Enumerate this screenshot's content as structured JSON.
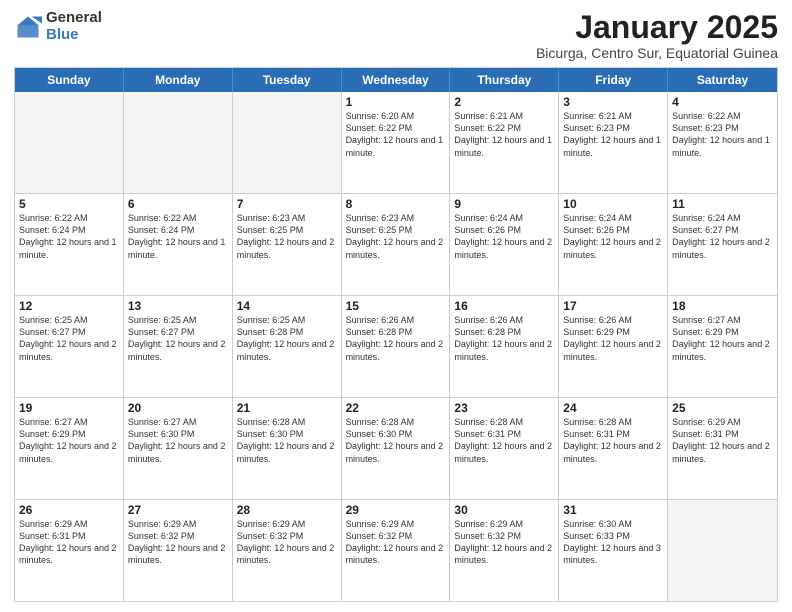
{
  "logo": {
    "general": "General",
    "blue": "Blue"
  },
  "header": {
    "title": "January 2025",
    "subtitle": "Bicurga, Centro Sur, Equatorial Guinea"
  },
  "weekdays": [
    "Sunday",
    "Monday",
    "Tuesday",
    "Wednesday",
    "Thursday",
    "Friday",
    "Saturday"
  ],
  "weeks": [
    [
      {
        "num": "",
        "info": "",
        "empty": true
      },
      {
        "num": "",
        "info": "",
        "empty": true
      },
      {
        "num": "",
        "info": "",
        "empty": true
      },
      {
        "num": "1",
        "info": "Sunrise: 6:20 AM\nSunset: 6:22 PM\nDaylight: 12 hours and 1 minute.",
        "empty": false
      },
      {
        "num": "2",
        "info": "Sunrise: 6:21 AM\nSunset: 6:22 PM\nDaylight: 12 hours and 1 minute.",
        "empty": false
      },
      {
        "num": "3",
        "info": "Sunrise: 6:21 AM\nSunset: 6:23 PM\nDaylight: 12 hours and 1 minute.",
        "empty": false
      },
      {
        "num": "4",
        "info": "Sunrise: 6:22 AM\nSunset: 6:23 PM\nDaylight: 12 hours and 1 minute.",
        "empty": false
      }
    ],
    [
      {
        "num": "5",
        "info": "Sunrise: 6:22 AM\nSunset: 6:24 PM\nDaylight: 12 hours and 1 minute.",
        "empty": false
      },
      {
        "num": "6",
        "info": "Sunrise: 6:22 AM\nSunset: 6:24 PM\nDaylight: 12 hours and 1 minute.",
        "empty": false
      },
      {
        "num": "7",
        "info": "Sunrise: 6:23 AM\nSunset: 6:25 PM\nDaylight: 12 hours and 2 minutes.",
        "empty": false
      },
      {
        "num": "8",
        "info": "Sunrise: 6:23 AM\nSunset: 6:25 PM\nDaylight: 12 hours and 2 minutes.",
        "empty": false
      },
      {
        "num": "9",
        "info": "Sunrise: 6:24 AM\nSunset: 6:26 PM\nDaylight: 12 hours and 2 minutes.",
        "empty": false
      },
      {
        "num": "10",
        "info": "Sunrise: 6:24 AM\nSunset: 6:26 PM\nDaylight: 12 hours and 2 minutes.",
        "empty": false
      },
      {
        "num": "11",
        "info": "Sunrise: 6:24 AM\nSunset: 6:27 PM\nDaylight: 12 hours and 2 minutes.",
        "empty": false
      }
    ],
    [
      {
        "num": "12",
        "info": "Sunrise: 6:25 AM\nSunset: 6:27 PM\nDaylight: 12 hours and 2 minutes.",
        "empty": false
      },
      {
        "num": "13",
        "info": "Sunrise: 6:25 AM\nSunset: 6:27 PM\nDaylight: 12 hours and 2 minutes.",
        "empty": false
      },
      {
        "num": "14",
        "info": "Sunrise: 6:25 AM\nSunset: 6:28 PM\nDaylight: 12 hours and 2 minutes.",
        "empty": false
      },
      {
        "num": "15",
        "info": "Sunrise: 6:26 AM\nSunset: 6:28 PM\nDaylight: 12 hours and 2 minutes.",
        "empty": false
      },
      {
        "num": "16",
        "info": "Sunrise: 6:26 AM\nSunset: 6:28 PM\nDaylight: 12 hours and 2 minutes.",
        "empty": false
      },
      {
        "num": "17",
        "info": "Sunrise: 6:26 AM\nSunset: 6:29 PM\nDaylight: 12 hours and 2 minutes.",
        "empty": false
      },
      {
        "num": "18",
        "info": "Sunrise: 6:27 AM\nSunset: 6:29 PM\nDaylight: 12 hours and 2 minutes.",
        "empty": false
      }
    ],
    [
      {
        "num": "19",
        "info": "Sunrise: 6:27 AM\nSunset: 6:29 PM\nDaylight: 12 hours and 2 minutes.",
        "empty": false
      },
      {
        "num": "20",
        "info": "Sunrise: 6:27 AM\nSunset: 6:30 PM\nDaylight: 12 hours and 2 minutes.",
        "empty": false
      },
      {
        "num": "21",
        "info": "Sunrise: 6:28 AM\nSunset: 6:30 PM\nDaylight: 12 hours and 2 minutes.",
        "empty": false
      },
      {
        "num": "22",
        "info": "Sunrise: 6:28 AM\nSunset: 6:30 PM\nDaylight: 12 hours and 2 minutes.",
        "empty": false
      },
      {
        "num": "23",
        "info": "Sunrise: 6:28 AM\nSunset: 6:31 PM\nDaylight: 12 hours and 2 minutes.",
        "empty": false
      },
      {
        "num": "24",
        "info": "Sunrise: 6:28 AM\nSunset: 6:31 PM\nDaylight: 12 hours and 2 minutes.",
        "empty": false
      },
      {
        "num": "25",
        "info": "Sunrise: 6:29 AM\nSunset: 6:31 PM\nDaylight: 12 hours and 2 minutes.",
        "empty": false
      }
    ],
    [
      {
        "num": "26",
        "info": "Sunrise: 6:29 AM\nSunset: 6:31 PM\nDaylight: 12 hours and 2 minutes.",
        "empty": false
      },
      {
        "num": "27",
        "info": "Sunrise: 6:29 AM\nSunset: 6:32 PM\nDaylight: 12 hours and 2 minutes.",
        "empty": false
      },
      {
        "num": "28",
        "info": "Sunrise: 6:29 AM\nSunset: 6:32 PM\nDaylight: 12 hours and 2 minutes.",
        "empty": false
      },
      {
        "num": "29",
        "info": "Sunrise: 6:29 AM\nSunset: 6:32 PM\nDaylight: 12 hours and 2 minutes.",
        "empty": false
      },
      {
        "num": "30",
        "info": "Sunrise: 6:29 AM\nSunset: 6:32 PM\nDaylight: 12 hours and 2 minutes.",
        "empty": false
      },
      {
        "num": "31",
        "info": "Sunrise: 6:30 AM\nSunset: 6:33 PM\nDaylight: 12 hours and 3 minutes.",
        "empty": false
      },
      {
        "num": "",
        "info": "",
        "empty": true
      }
    ]
  ]
}
